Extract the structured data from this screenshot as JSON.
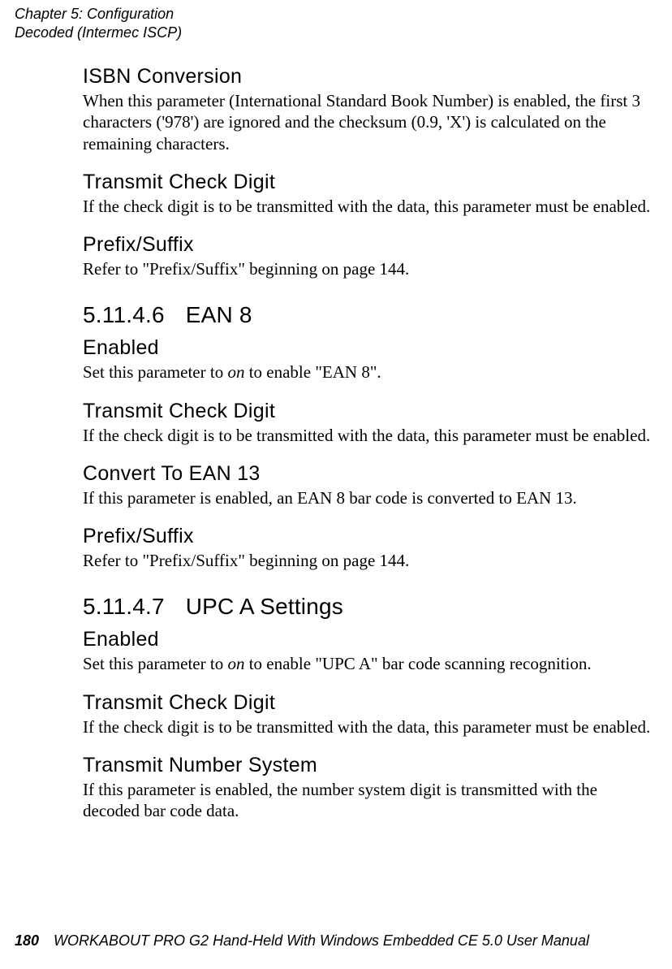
{
  "header": {
    "chapter": "Chapter 5: Configuration",
    "section": "Decoded (Intermec ISCP)"
  },
  "s1": {
    "h": "ISBN Conversion",
    "p": "When this parameter (International Standard Book Number) is enabled, the first 3 characters ('978') are ignored and the checksum (0.9, 'X') is calculated on the remaining characters."
  },
  "s2": {
    "h": "Transmit Check Digit",
    "p": "If the check digit is to be transmitted with the data, this parameter must be enabled."
  },
  "s3": {
    "h": "Prefix/Suffix",
    "p": "Refer to \"Prefix/Suffix\" beginning on page 144."
  },
  "s4": {
    "num": "5.11.4.6",
    "title": "EAN 8"
  },
  "s5": {
    "h": "Enabled",
    "p_pre": "Set this parameter to ",
    "p_em": "on",
    "p_post": " to enable \"EAN 8\"."
  },
  "s6": {
    "h": "Transmit Check Digit",
    "p": "If the check digit is to be transmitted with the data, this parameter must be enabled."
  },
  "s7": {
    "h": "Convert To EAN 13",
    "p": "If this parameter is enabled, an EAN 8 bar code is converted to EAN 13."
  },
  "s8": {
    "h": "Prefix/Suffix",
    "p": "Refer to \"Prefix/Suffix\" beginning on page 144."
  },
  "s9": {
    "num": "5.11.4.7",
    "title": "UPC A Settings"
  },
  "s10": {
    "h": "Enabled",
    "p_pre": "Set this parameter to ",
    "p_em": "on",
    "p_post": " to enable \"UPC A\" bar code scanning recognition."
  },
  "s11": {
    "h": "Transmit Check Digit",
    "p": "If the check digit is to be transmitted with the data, this parameter must be enabled."
  },
  "s12": {
    "h": "Transmit Number System",
    "p": "If this parameter is enabled, the number system digit is transmitted with the decoded bar code data."
  },
  "footer": {
    "page": "180",
    "title": "WORKABOUT PRO G2 Hand-Held With Windows Embedded CE 5.0 User Manual"
  }
}
